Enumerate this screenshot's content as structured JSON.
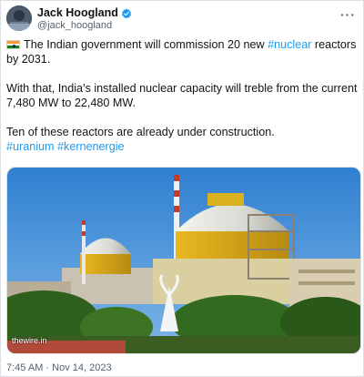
{
  "tweet": {
    "author": {
      "name": "Jack Hoogland",
      "handle": "@jack_hoogland",
      "verified": true
    },
    "more_label": "···",
    "paragraph1": {
      "flag_icon": "india-flag-icon",
      "before": "The Indian government will commission 20 new ",
      "link": "#nuclear",
      "after": " reactors by 2031."
    },
    "paragraph2": "With that, India’s installed nuclear capacity will treble from the current 7,480 MW to 22,480 MW.",
    "paragraph3": "Ten of these reactors are already under construction.",
    "hashtags": [
      "#uranium",
      "#kernenergie"
    ],
    "media": {
      "watermark": "thewire.in"
    },
    "timestamp": "7:45 AM · Nov 14, 2023"
  },
  "colors": {
    "link": "#1d9bf0",
    "secondary_text": "#536471",
    "text": "#0f1419"
  }
}
